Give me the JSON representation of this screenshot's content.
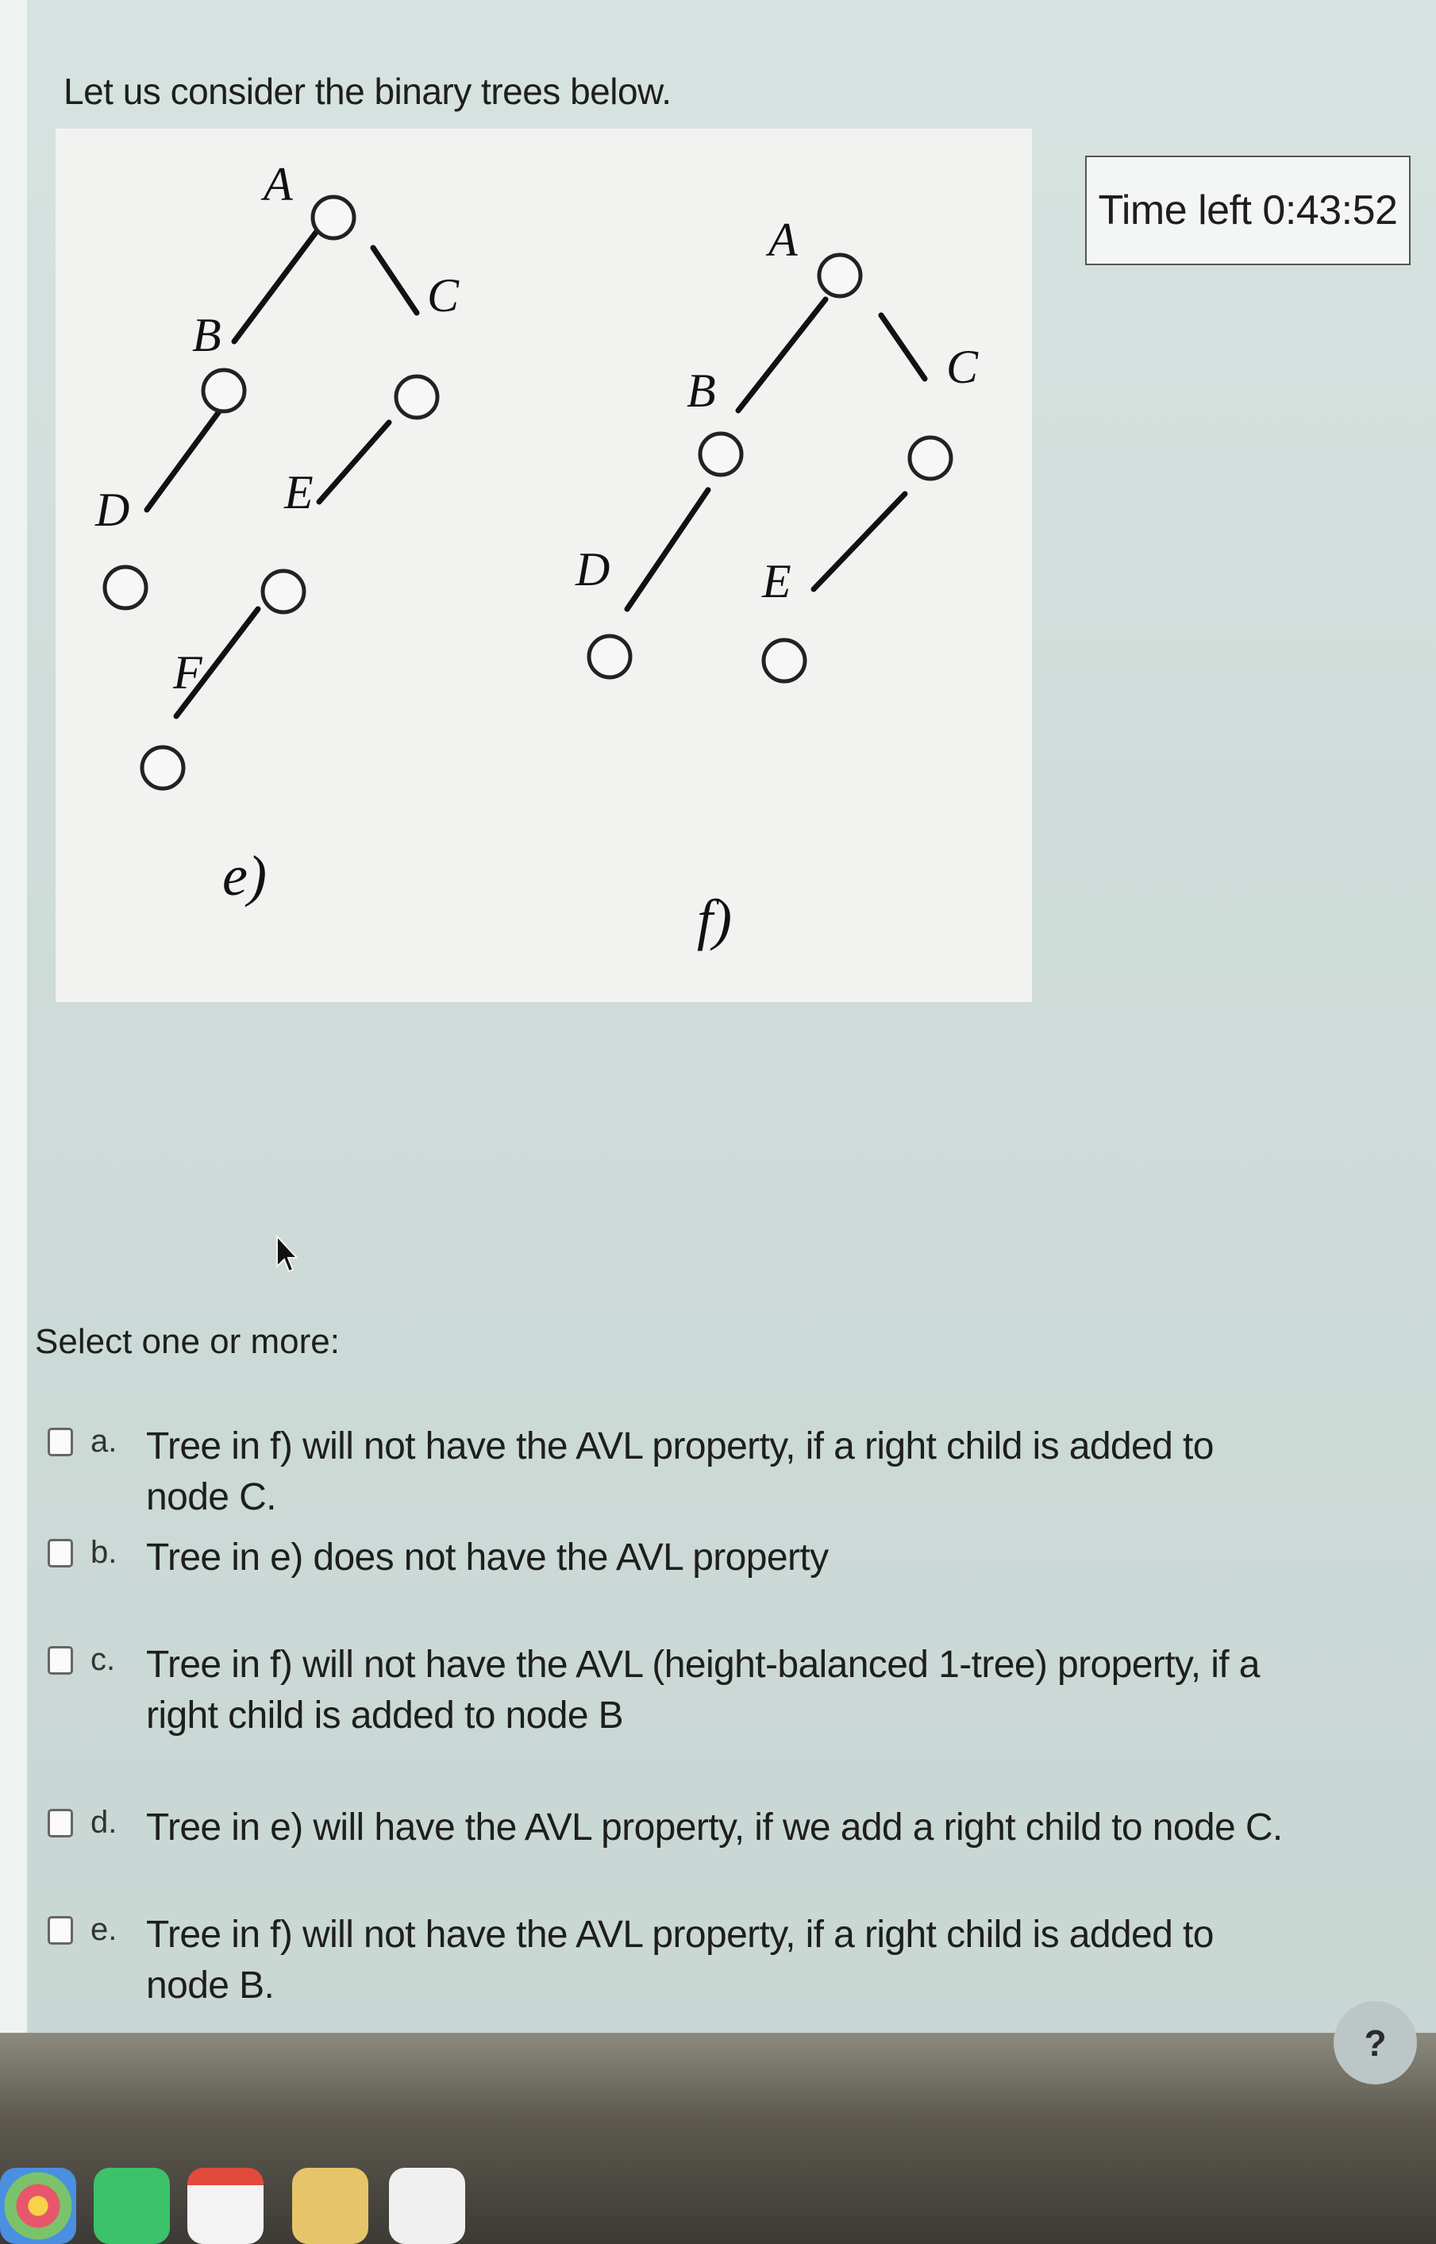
{
  "question": {
    "intro": "Let us consider the binary trees below.",
    "figure": {
      "tree_e": {
        "caption": "e)",
        "node_labels": [
          "A",
          "B",
          "C",
          "D",
          "E",
          "F"
        ]
      },
      "tree_f": {
        "caption": "f)",
        "node_labels": [
          "A",
          "B",
          "C",
          "D",
          "E"
        ]
      }
    },
    "prompt": "Select one or more:",
    "options": [
      {
        "letter": "a.",
        "text": "Tree in f) will not have the AVL property, if a right child is added to node C."
      },
      {
        "letter": "b.",
        "text": "Tree in e)  does not have the AVL property"
      },
      {
        "letter": "c.",
        "text": "Tree in f) will not have the AVL (height-balanced 1-tree) property, if a right child is added to node B"
      },
      {
        "letter": "d.",
        "text": "Tree in e) will have the AVL property, if we add a right child to node C."
      },
      {
        "letter": "e.",
        "text": "Tree in f) will not have the AVL property, if a right child is added to node B."
      }
    ]
  },
  "timer": {
    "text": "Time left 0:43:52"
  },
  "help": {
    "label": "?"
  }
}
